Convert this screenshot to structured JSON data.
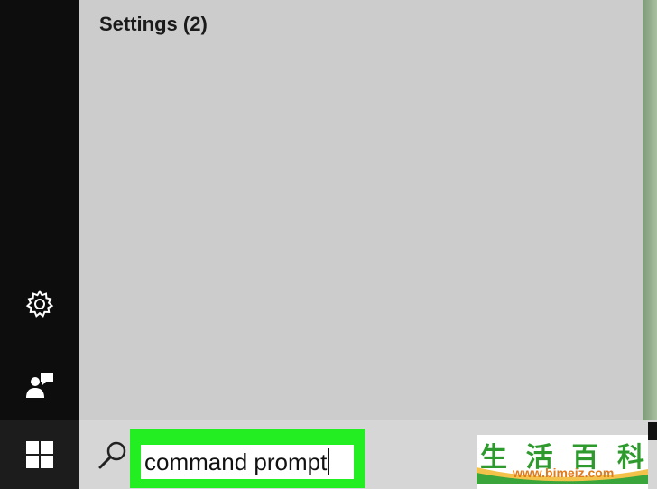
{
  "panel": {
    "title": "Settings (2)"
  },
  "sidebar": {
    "items": [
      {
        "icon": "gear-icon",
        "label": ""
      },
      {
        "icon": "feedback-icon",
        "label": ""
      }
    ]
  },
  "taskbar": {
    "start_icon": "windows-logo-icon",
    "search_icon": "search-icon",
    "search_value": "command prompt"
  },
  "watermark": {
    "chars": [
      "生",
      "活",
      "百",
      "科"
    ],
    "url": "www.bimeiz.com"
  },
  "colors": {
    "highlight": "#22ee22",
    "panel_bg": "#cccccc",
    "sidebar_bg": "#0d0d0d"
  }
}
